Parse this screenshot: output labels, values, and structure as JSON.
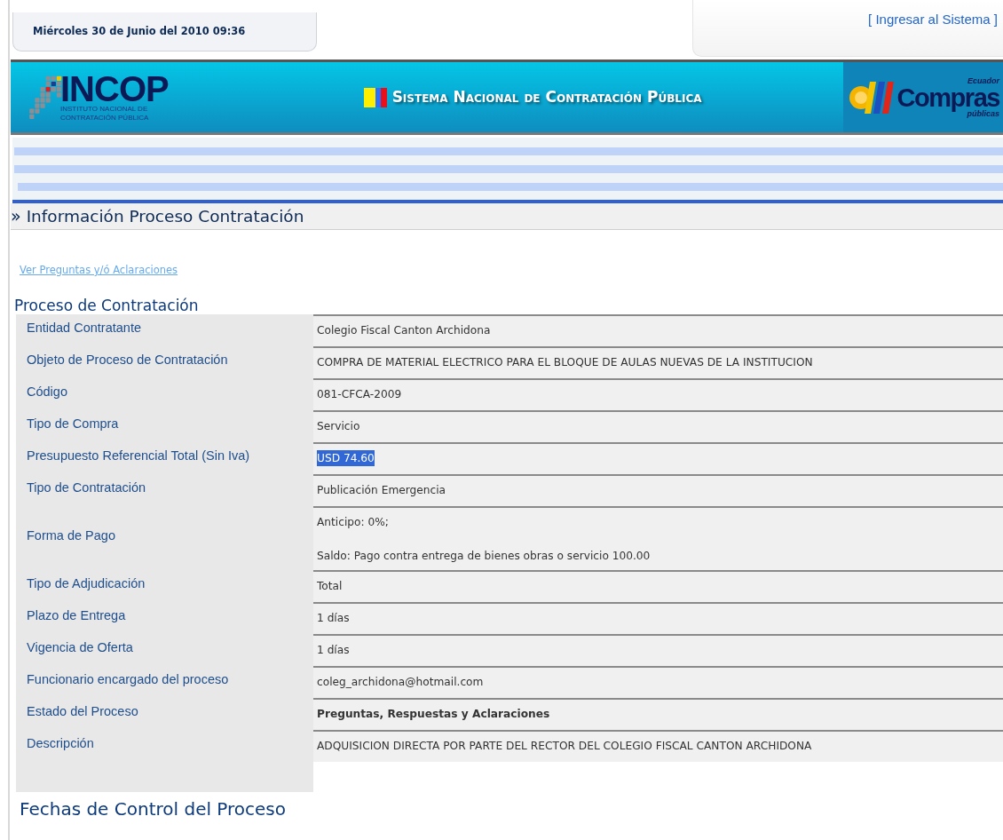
{
  "header": {
    "date": "Miércoles 30 de Junio del 2010 09:36",
    "login_link": "[ Ingresar al Sistema ]"
  },
  "banner": {
    "logo_name": "INCOP",
    "logo_subtitle": [
      "INSTITUTO NACIONAL DE",
      "CONTRATACIÓN PÚBLICA"
    ],
    "title": "Sistema Nacional de Contratación Pública",
    "partner_top": "Ecuador",
    "partner_name": "Compras",
    "partner_bottom": "públicas"
  },
  "page_heading": {
    "marker": "»",
    "title": "Información Proceso Contratación"
  },
  "questions_link": "Ver Preguntas y/ó Aclaraciones",
  "section_title": "Proceso de Contratación",
  "rows": [
    {
      "label": "Entidad Contratante",
      "lines": [
        "Colegio Fiscal Canton Archidona"
      ],
      "highlighted": false,
      "bold": false
    },
    {
      "label": "Objeto de Proceso de Contratación",
      "lines": [
        "COMPRA DE MATERIAL ELECTRICO PARA EL BLOQUE DE AULAS NUEVAS DE LA INSTITUCION"
      ],
      "highlighted": false,
      "bold": false
    },
    {
      "label": "Código",
      "lines": [
        "081-CFCA-2009"
      ],
      "highlighted": false,
      "bold": false
    },
    {
      "label": "Tipo de Compra",
      "lines": [
        "Servicio"
      ],
      "highlighted": false,
      "bold": false
    },
    {
      "label": "Presupuesto Referencial Total (Sin Iva)",
      "lines": [
        "USD 74.60"
      ],
      "highlighted": true,
      "bold": false
    },
    {
      "label": "Tipo de Contratación",
      "lines": [
        "Publicación Emergencia"
      ],
      "highlighted": false,
      "bold": false
    },
    {
      "label": "Forma de Pago",
      "lines": [
        "Anticipo: 0%;",
        "Saldo: Pago contra entrega de bienes obras o servicio 100.00"
      ],
      "highlighted": false,
      "bold": false
    },
    {
      "label": "Tipo de Adjudicación",
      "lines": [
        "Total"
      ],
      "highlighted": false,
      "bold": false
    },
    {
      "label": "Plazo de Entrega",
      "lines": [
        "1 días"
      ],
      "highlighted": false,
      "bold": false
    },
    {
      "label": "Vigencia de Oferta",
      "lines": [
        "1 días"
      ],
      "highlighted": false,
      "bold": false
    },
    {
      "label": "Funcionario encargado del proceso",
      "lines": [
        "coleg_archidona@hotmail.com"
      ],
      "highlighted": false,
      "bold": false
    },
    {
      "label": "Estado del Proceso",
      "lines": [
        "Preguntas, Respuestas y Aclaraciones"
      ],
      "highlighted": false,
      "bold": true
    },
    {
      "label": "Descripción",
      "lines": [
        "ADQUISICION DIRECTA POR PARTE DEL RECTOR DEL COLEGIO FISCAL CANTON ARCHIDONA"
      ],
      "highlighted": false,
      "bold": false
    }
  ],
  "next_section_title": "Fechas de Control del Proceso"
}
